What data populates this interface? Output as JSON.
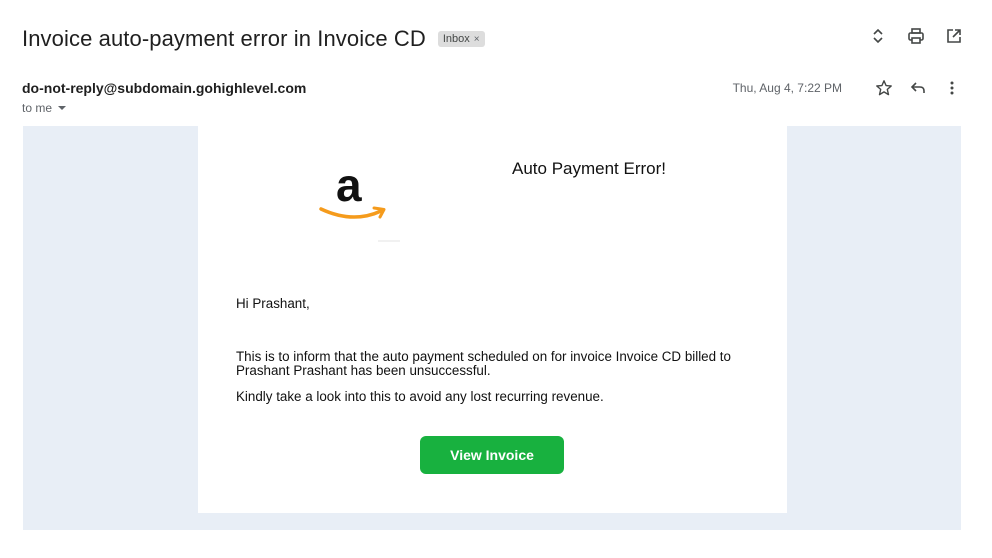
{
  "header": {
    "subject": "Invoice auto-payment error in Invoice CD",
    "label": "Inbox",
    "label_remove": "×"
  },
  "toolbar_icons": [
    "expand-collapse-icon",
    "print-icon",
    "open-in-new-window-icon"
  ],
  "message": {
    "sender": "do-not-reply@subdomain.gohighlevel.com",
    "recipient": "to me",
    "date": "Thu, Aug 4, 7:22 PM",
    "icons": [
      "star-icon",
      "reply-icon",
      "more-vert-icon"
    ]
  },
  "email": {
    "logo_letter": "a",
    "heading": "Auto Payment Error!",
    "greeting": "Hi Prashant,",
    "paragraph1": "This is to inform that the auto payment scheduled on for invoice Invoice CD billed to Prashant Prashant has been unsuccessful.",
    "paragraph2": "Kindly take a look into this to avoid any lost recurring revenue.",
    "button_label": "View Invoice"
  },
  "colors": {
    "background_panel": "#e8eef6",
    "button": "#18b13f",
    "amazon_smile": "#f59b1c"
  }
}
